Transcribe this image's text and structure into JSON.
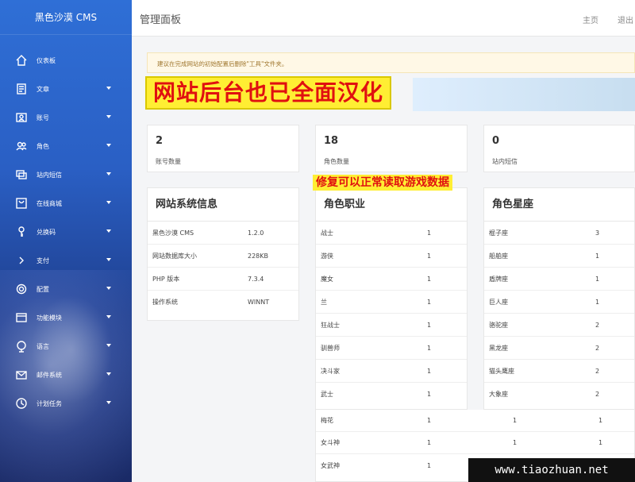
{
  "app": {
    "brand": "黑色沙漠 CMS"
  },
  "header": {
    "title": "管理面板",
    "home": "主页",
    "logout": "退出"
  },
  "sidebar": {
    "items": [
      {
        "label": "仪表板",
        "icon": "home-icon",
        "caret": false
      },
      {
        "label": "文章",
        "icon": "article-icon",
        "caret": true
      },
      {
        "label": "账号",
        "icon": "account-card-icon",
        "caret": true
      },
      {
        "label": "角色",
        "icon": "users-icon",
        "caret": true
      },
      {
        "label": "站内短信",
        "icon": "messages-icon",
        "caret": true
      },
      {
        "label": "在线商城",
        "icon": "shop-icon",
        "caret": true
      },
      {
        "label": "兑换码",
        "icon": "key-icon",
        "caret": true
      },
      {
        "label": "支付",
        "icon": "chevron-right-icon",
        "caret": true
      },
      {
        "label": "配置",
        "icon": "gear-icon",
        "caret": true
      },
      {
        "label": "功能模块",
        "icon": "module-icon",
        "caret": true
      },
      {
        "label": "语言",
        "icon": "globe-icon",
        "caret": true
      },
      {
        "label": "邮件系统",
        "icon": "mail-icon",
        "caret": true
      },
      {
        "label": "计划任务",
        "icon": "clock-icon",
        "caret": true
      }
    ]
  },
  "alert": {
    "text": "建议在完成网站的初始配置后删除\"工具\"文件夹。"
  },
  "overlays": {
    "main": "网站后台也已全面汉化",
    "second": "修复可以正常读取游戏数据"
  },
  "stats": [
    {
      "value": "2",
      "label": "账号数量"
    },
    {
      "value": "18",
      "label": "角色数量"
    },
    {
      "value": "0",
      "label": "站内短信"
    }
  ],
  "site_info": {
    "title": "网站系统信息",
    "rows": [
      {
        "k": "黑色沙漠 CMS",
        "v": "1.2.0"
      },
      {
        "k": "网站数据库大小",
        "v": "228KB"
      },
      {
        "k": "PHP 版本",
        "v": "7.3.4"
      },
      {
        "k": "操作系统",
        "v": "WINNT"
      }
    ]
  },
  "roles": {
    "title": "角色职业",
    "rows": [
      {
        "k": "战士",
        "v": "1"
      },
      {
        "k": "游侠",
        "v": "1"
      },
      {
        "k": "魔女",
        "v": "1"
      },
      {
        "k": "兰",
        "v": "1"
      },
      {
        "k": "狂战士",
        "v": "1"
      },
      {
        "k": "驯兽师",
        "v": "1"
      },
      {
        "k": "决斗家",
        "v": "1"
      },
      {
        "k": "武士",
        "v": "1"
      }
    ]
  },
  "stars": {
    "title": "角色星座",
    "rows": [
      {
        "k": "棍子座",
        "v": "3"
      },
      {
        "k": "船舶座",
        "v": "1"
      },
      {
        "k": "盾牌座",
        "v": "1"
      },
      {
        "k": "巨人座",
        "v": "1"
      },
      {
        "k": "骆驼座",
        "v": "2"
      },
      {
        "k": "黑龙座",
        "v": "2"
      },
      {
        "k": "猫头鹰座",
        "v": "2"
      },
      {
        "k": "大象座",
        "v": "2"
      }
    ]
  },
  "extra_rows": [
    {
      "a": "梅花",
      "b": "1",
      "c": "1",
      "d": "1"
    },
    {
      "a": "女斗神",
      "b": "1",
      "c": "1",
      "d": "1"
    },
    {
      "a": "女武神",
      "b": "1",
      "c": "",
      "d": ""
    }
  ],
  "watermark": "www.tiaozhuan.net"
}
